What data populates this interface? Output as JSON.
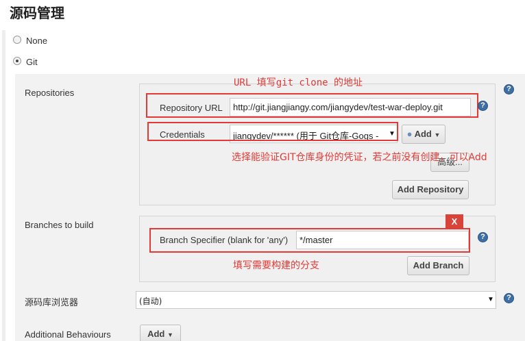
{
  "section": {
    "title": "源码管理"
  },
  "scm_options": [
    {
      "label": "None",
      "selected": false
    },
    {
      "label": "Git",
      "selected": true
    }
  ],
  "repositories": {
    "label": "Repositories",
    "repo_url_label": "Repository URL",
    "repo_url_value": "http://git.jiangjiangy.com/jiangydev/test-war-deploy.git",
    "credentials_label": "Credentials",
    "credentials_value": "jiangydev/****** (用于 Git仓库-Gogs -",
    "add_label": "Add",
    "advanced_label": "高级...",
    "add_repository_label": "Add Repository"
  },
  "branches": {
    "label": "Branches to build",
    "specifier_label": "Branch Specifier (blank for 'any')",
    "specifier_value": "*/master",
    "delete_label": "X",
    "add_branch_label": "Add Branch"
  },
  "browser": {
    "label": "源码库浏览器",
    "value": "(自动)"
  },
  "additional": {
    "label": "Additional Behaviours",
    "add_label": "Add"
  },
  "help_glyph": "?",
  "annotations": {
    "url": "URL 填写git clone 的地址",
    "credentials": "选择能验证GIT仓库身份的凭证，若之前没有创建，可以Add",
    "branch": "填写需要构建的分支"
  },
  "colors": {
    "annotation_red": "#e53935",
    "help_blue": "#3d6fa6",
    "delete_red": "#d9443a"
  }
}
